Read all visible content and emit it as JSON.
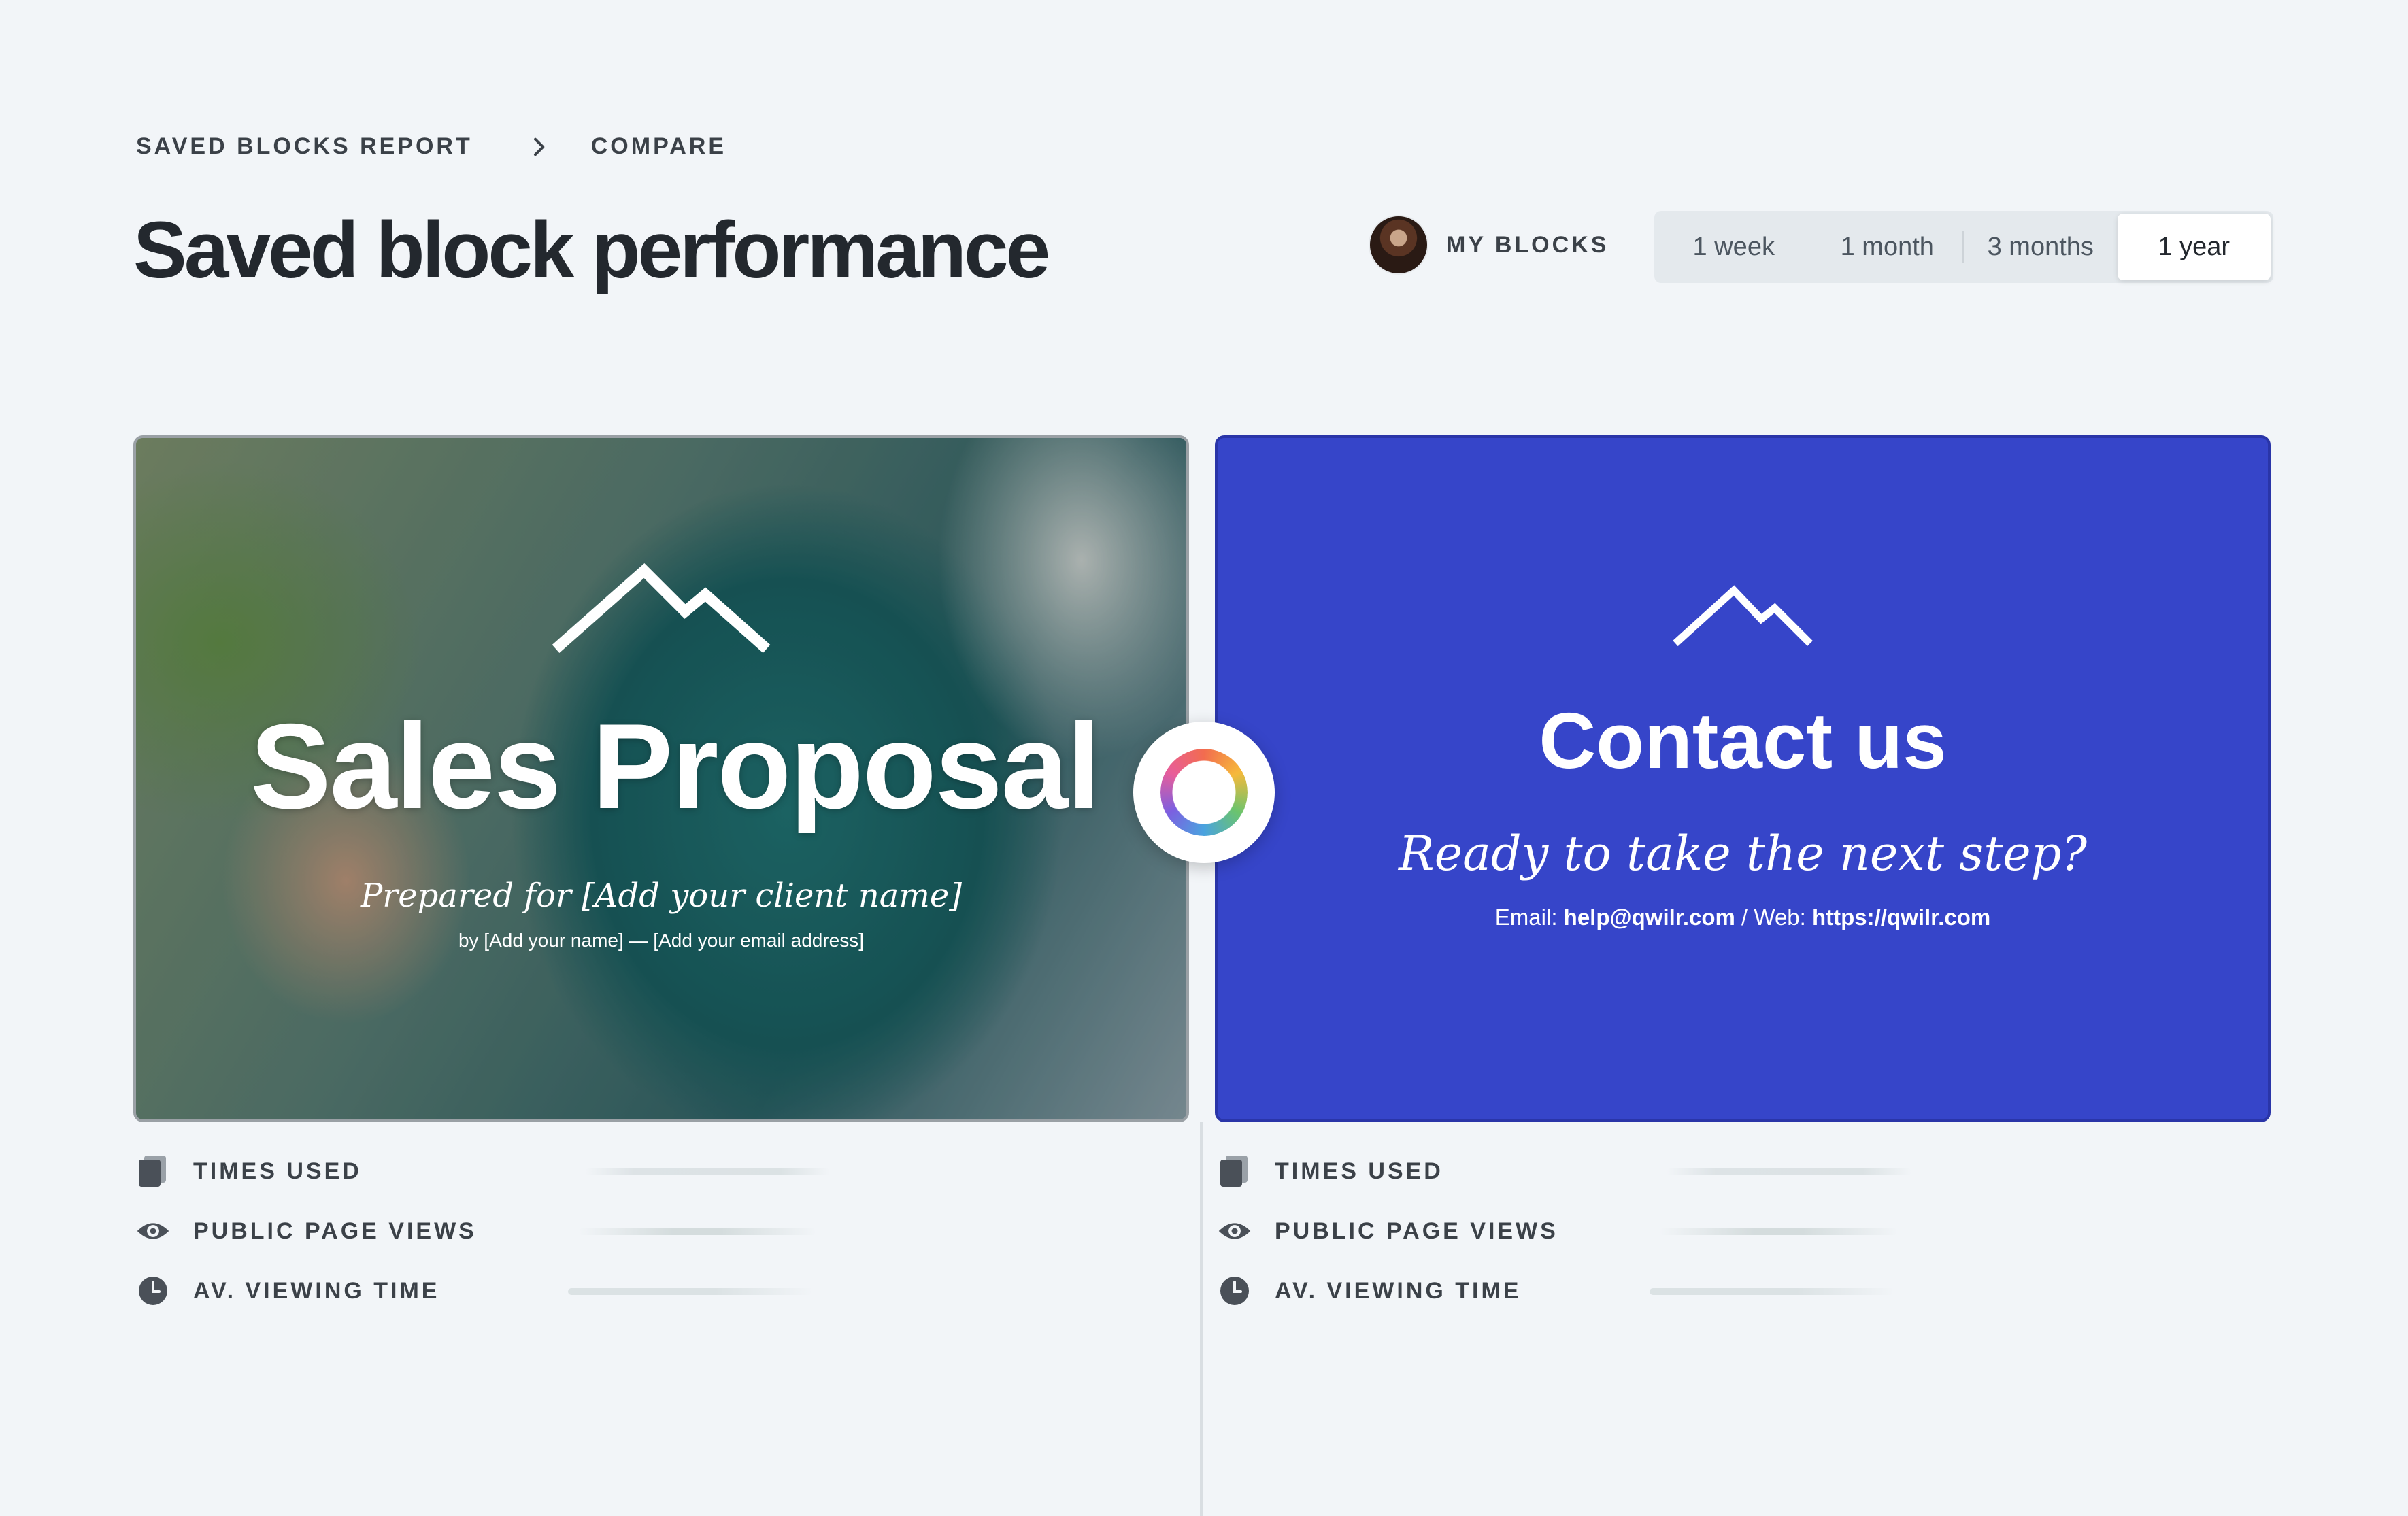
{
  "breadcrumb": {
    "items": [
      "SAVED BLOCKS REPORT",
      "COMPARE"
    ]
  },
  "page_title": "Saved block performance",
  "filters": {
    "my_blocks_label": "MY BLOCKS",
    "periods": [
      {
        "label": "1 week",
        "active": false
      },
      {
        "label": "1 month",
        "active": false
      },
      {
        "label": "3 months",
        "active": false
      },
      {
        "label": "1 year",
        "active": true
      }
    ]
  },
  "blocks": [
    {
      "title": "Sales Proposal",
      "subtitle": "Prepared for [Add your client name]",
      "byline": "by [Add your name] — [Add your email address]",
      "stats": [
        "TIMES USED",
        "PUBLIC PAGE VIEWS",
        "AV. VIEWING TIME"
      ]
    },
    {
      "title": "Contact us",
      "subtitle": "Ready to take the next step?",
      "contact": {
        "email_label": "Email:",
        "email": "help@qwilr.com",
        "separator": " / ",
        "web_label": "Web:",
        "web": "https://qwilr.com"
      },
      "stats": [
        "TIMES USED",
        "PUBLIC PAGE VIEWS",
        "AV. VIEWING TIME"
      ]
    }
  ],
  "icons": {
    "breadcrumb_separator": "chevron-right-icon",
    "compare": "compare-ring-icon",
    "block_logo": "mountain-icon",
    "times_used": "pages-icon",
    "views": "eye-icon",
    "viewing_time": "clock-icon"
  },
  "colors": {
    "background": "#f2f5f8",
    "contact_card": "#3645c9",
    "text_dark": "#23282e"
  }
}
